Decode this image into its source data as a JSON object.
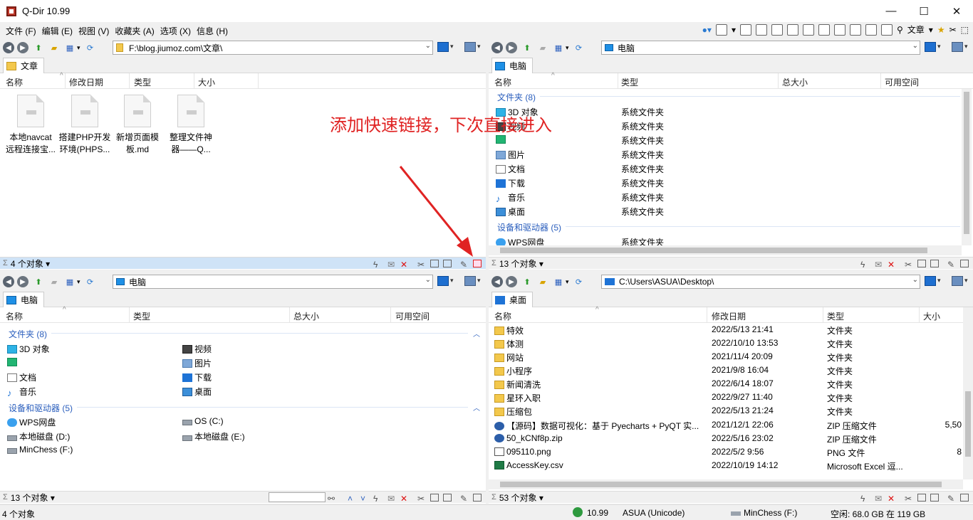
{
  "app": {
    "title": "Q-Dir 10.99"
  },
  "menu": [
    "文件 (F)",
    "编辑 (E)",
    "视图 (V)",
    "收藏夹 (A)",
    "选项 (X)",
    "信息 (H)"
  ],
  "toolbar": {
    "text": "文章"
  },
  "annotation": "添加快速链接，下次直接进入",
  "pane_tl": {
    "path": "F:\\blog.jiumoz.com\\文章\\",
    "tab": "文章",
    "cols": [
      "名称",
      "修改日期",
      "类型",
      "大小"
    ],
    "files": [
      "本地navcat\n远程连接宝...",
      "搭建PHP开发\n环境(PHPS...",
      "新增页面模\n板.md",
      "整理文件神\n器——Q..."
    ],
    "status": "4 个对象 ▾"
  },
  "pane_tr": {
    "path": "电脑",
    "tab": "电脑",
    "cols": [
      "名称",
      "类型",
      "总大小",
      "可用空间"
    ],
    "group1": "文件夹 (8)",
    "group2": "设备和驱动器 (5)",
    "rows": [
      [
        "3D 对象",
        "系统文件夹"
      ],
      [
        "视频",
        "系统文件夹"
      ],
      [
        "",
        "系统文件夹"
      ],
      [
        "图片",
        "系统文件夹"
      ],
      [
        "文档",
        "系统文件夹"
      ],
      [
        "下载",
        "系统文件夹"
      ],
      [
        "音乐",
        "系统文件夹"
      ],
      [
        "桌面",
        "系统文件夹"
      ]
    ],
    "drive": [
      "WPS网盘",
      "系统文件夹"
    ],
    "status": "13 个对象 ▾"
  },
  "pane_bl": {
    "path": "电脑",
    "tab": "电脑",
    "cols": [
      "名称",
      "类型",
      "总大小",
      "可用空间"
    ],
    "group1": "文件夹 (8)",
    "group2": "设备和驱动器 (5)",
    "left": [
      "3D 对象",
      "",
      "文档",
      "音乐"
    ],
    "right": [
      "视频",
      "图片",
      "下载",
      "桌面"
    ],
    "drives_left": [
      "WPS网盘",
      "本地磁盘 (D:)",
      "MinChess (F:)"
    ],
    "drives_right": [
      "OS (C:)",
      "本地磁盘 (E:)"
    ],
    "status": "13 个对象 ▾"
  },
  "pane_br": {
    "path": "C:\\Users\\ASUA\\Desktop\\",
    "tab": "桌面",
    "cols": [
      "名称",
      "修改日期",
      "类型",
      "大小"
    ],
    "rows": [
      [
        "特效",
        "2022/5/13 21:41",
        "文件夹",
        ""
      ],
      [
        "体测",
        "2022/10/10 13:53",
        "文件夹",
        ""
      ],
      [
        "网站",
        "2021/11/4 20:09",
        "文件夹",
        ""
      ],
      [
        "小程序",
        "2021/9/8 16:04",
        "文件夹",
        ""
      ],
      [
        "新闻清洗",
        "2022/6/14 18:07",
        "文件夹",
        ""
      ],
      [
        "星环入职",
        "2022/9/27 11:40",
        "文件夹",
        ""
      ],
      [
        "压缩包",
        "2022/5/13 21:24",
        "文件夹",
        ""
      ],
      [
        "【源码】数据可视化：基于 Pyecharts + PyQT 实...",
        "2021/12/1 22:06",
        "ZIP 压缩文件",
        "5,50"
      ],
      [
        "50_kCNf8p.zip",
        "2022/5/16 23:02",
        "ZIP 压缩文件",
        ""
      ],
      [
        "095110.png",
        "2022/5/2 9:56",
        "PNG 文件",
        "8"
      ],
      [
        "AccessKey.csv",
        "2022/10/19 14:12",
        "Microsoft Excel 逗...",
        ""
      ]
    ],
    "status": "53 个对象 ▾"
  },
  "appstatus": {
    "left": "4 个对象",
    "ver": "10.99",
    "user": "ASUA (Unicode)",
    "drive": "MinChess (F:)",
    "free": "空闲: 68.0 GB 在 119 GB"
  }
}
